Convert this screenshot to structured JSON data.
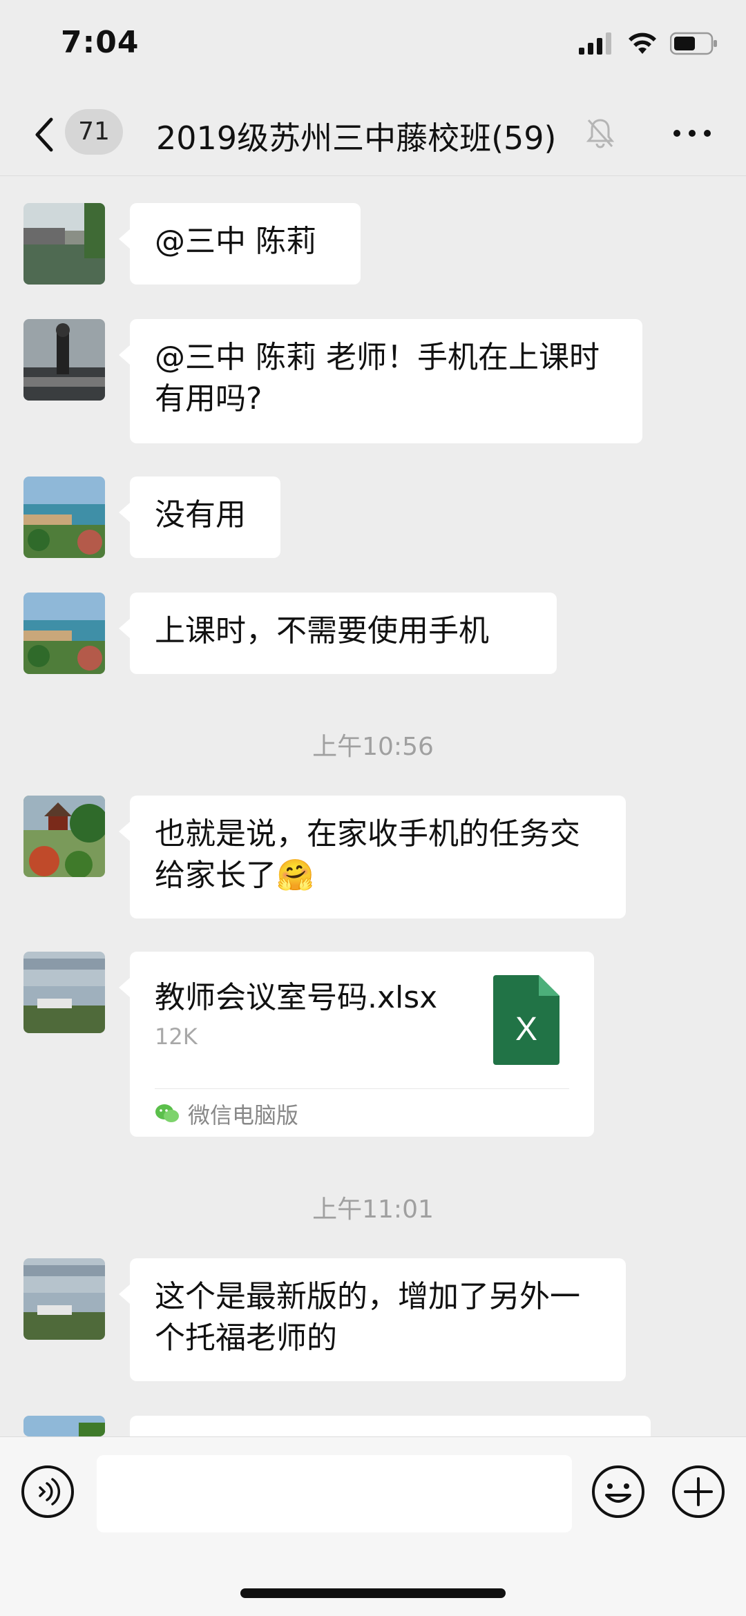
{
  "status": {
    "time": "7:04"
  },
  "nav": {
    "unread": "71",
    "title": "2019级苏州三中藤校班(59)"
  },
  "messages": [
    {
      "text": "@三中 陈莉"
    },
    {
      "text": "@三中 陈莉 老师！手机在上课时有用吗?"
    },
    {
      "text": "没有用"
    },
    {
      "text": "上课时，不需要使用手机"
    },
    {
      "text": "也就是说，在家收手机的任务交给家长了🤗"
    },
    {
      "text": "这个是最新版的，增加了另外一个托福老师的"
    }
  ],
  "timestamps": [
    "上午10:56",
    "上午11:01"
  ],
  "file": {
    "name": "教师会议室号码.xlsx",
    "size": "12K",
    "source": "微信电脑版",
    "icon_letter": "X"
  }
}
